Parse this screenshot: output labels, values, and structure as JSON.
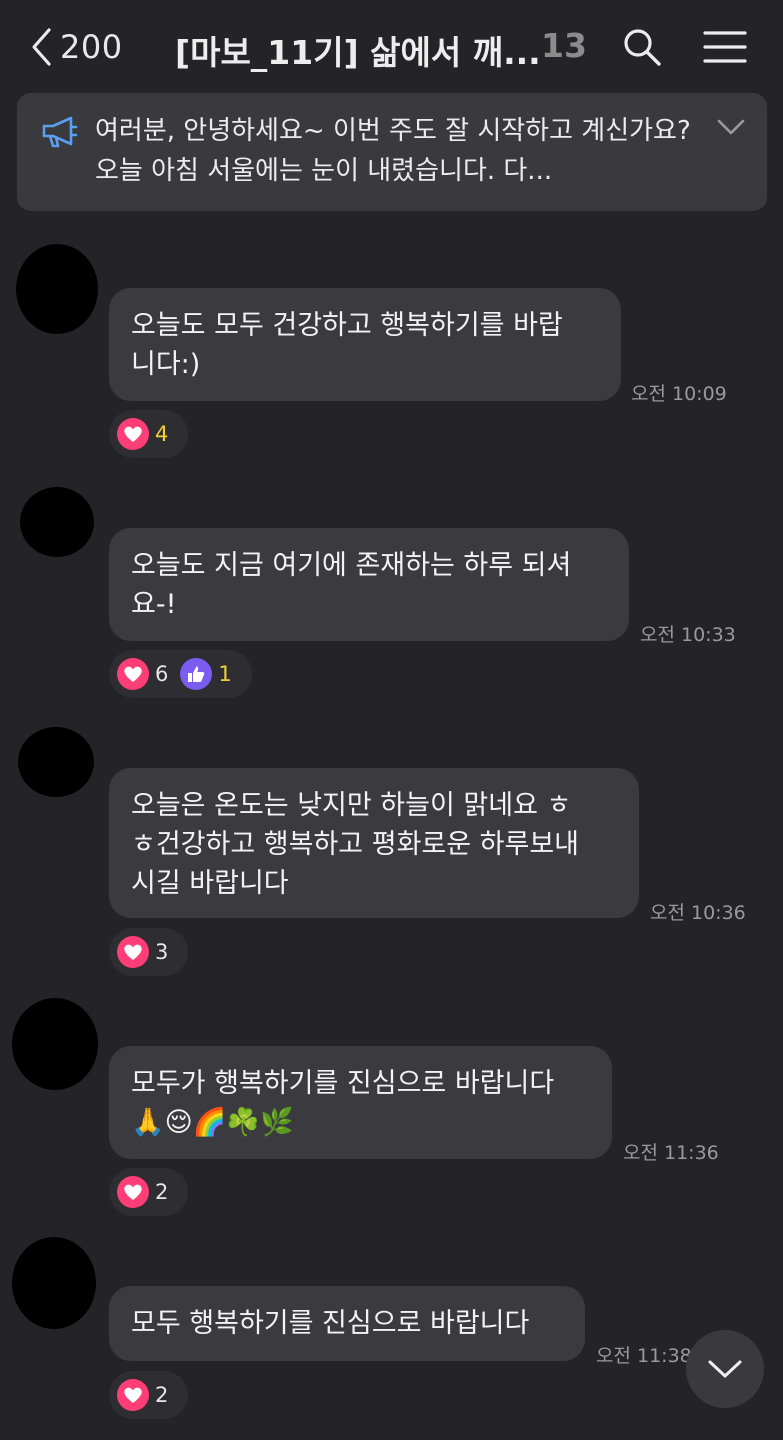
{
  "header": {
    "unread_count": "200",
    "room_title": "[마보_11기] 삶에서 깨...",
    "member_count": "13"
  },
  "notice": {
    "text": "여러분, 안녕하세요~ 이번 주도 잘 시작하고 계신가요? 오늘 아침 서울에는 눈이 내렸습니다. 다..."
  },
  "messages": [
    {
      "text": "오늘도 모두 건강하고 행복하기를 바랍\n니다:)",
      "time": "오전 10:09",
      "reactions": [
        {
          "icon": "heart",
          "count": "4"
        }
      ]
    },
    {
      "text": "오늘도 지금 여기에 존재하는 하루 되셔\n요-!",
      "time": "오전 10:33",
      "reactions": [
        {
          "icon": "heart",
          "count": "6"
        },
        {
          "icon": "thumbs-up",
          "count": "1"
        }
      ]
    },
    {
      "text": "오늘은 온도는 낮지만 하늘이 맑네요 ㅎ\nㅎ건강하고 행복하고 평화로운 하루보내\n시길 바랍니다",
      "time": "오전 10:36",
      "reactions": [
        {
          "icon": "heart",
          "count": "3"
        }
      ]
    },
    {
      "text": "모두가 행복하기를 진심으로 바랍니다\n🙏😌🌈☘️🌿",
      "time": "오전 11:36",
      "reactions": [
        {
          "icon": "heart",
          "count": "2"
        }
      ]
    },
    {
      "text": "모두 행복하기를 진심으로 바랍니다",
      "time": "오전 11:38",
      "reactions": [
        {
          "icon": "heart",
          "count": "2"
        }
      ]
    }
  ],
  "colors": {
    "background": "#242428",
    "bubble": "#3b3b3f",
    "heart": "#ff3d76",
    "thumb": "#7a5cf0",
    "highlight_count": "#f5d033"
  },
  "icons": [
    "back-chevron-icon",
    "search-icon",
    "hamburger-menu-icon",
    "megaphone-icon",
    "chevron-down-icon",
    "heart-icon",
    "thumbs-up-icon"
  ]
}
